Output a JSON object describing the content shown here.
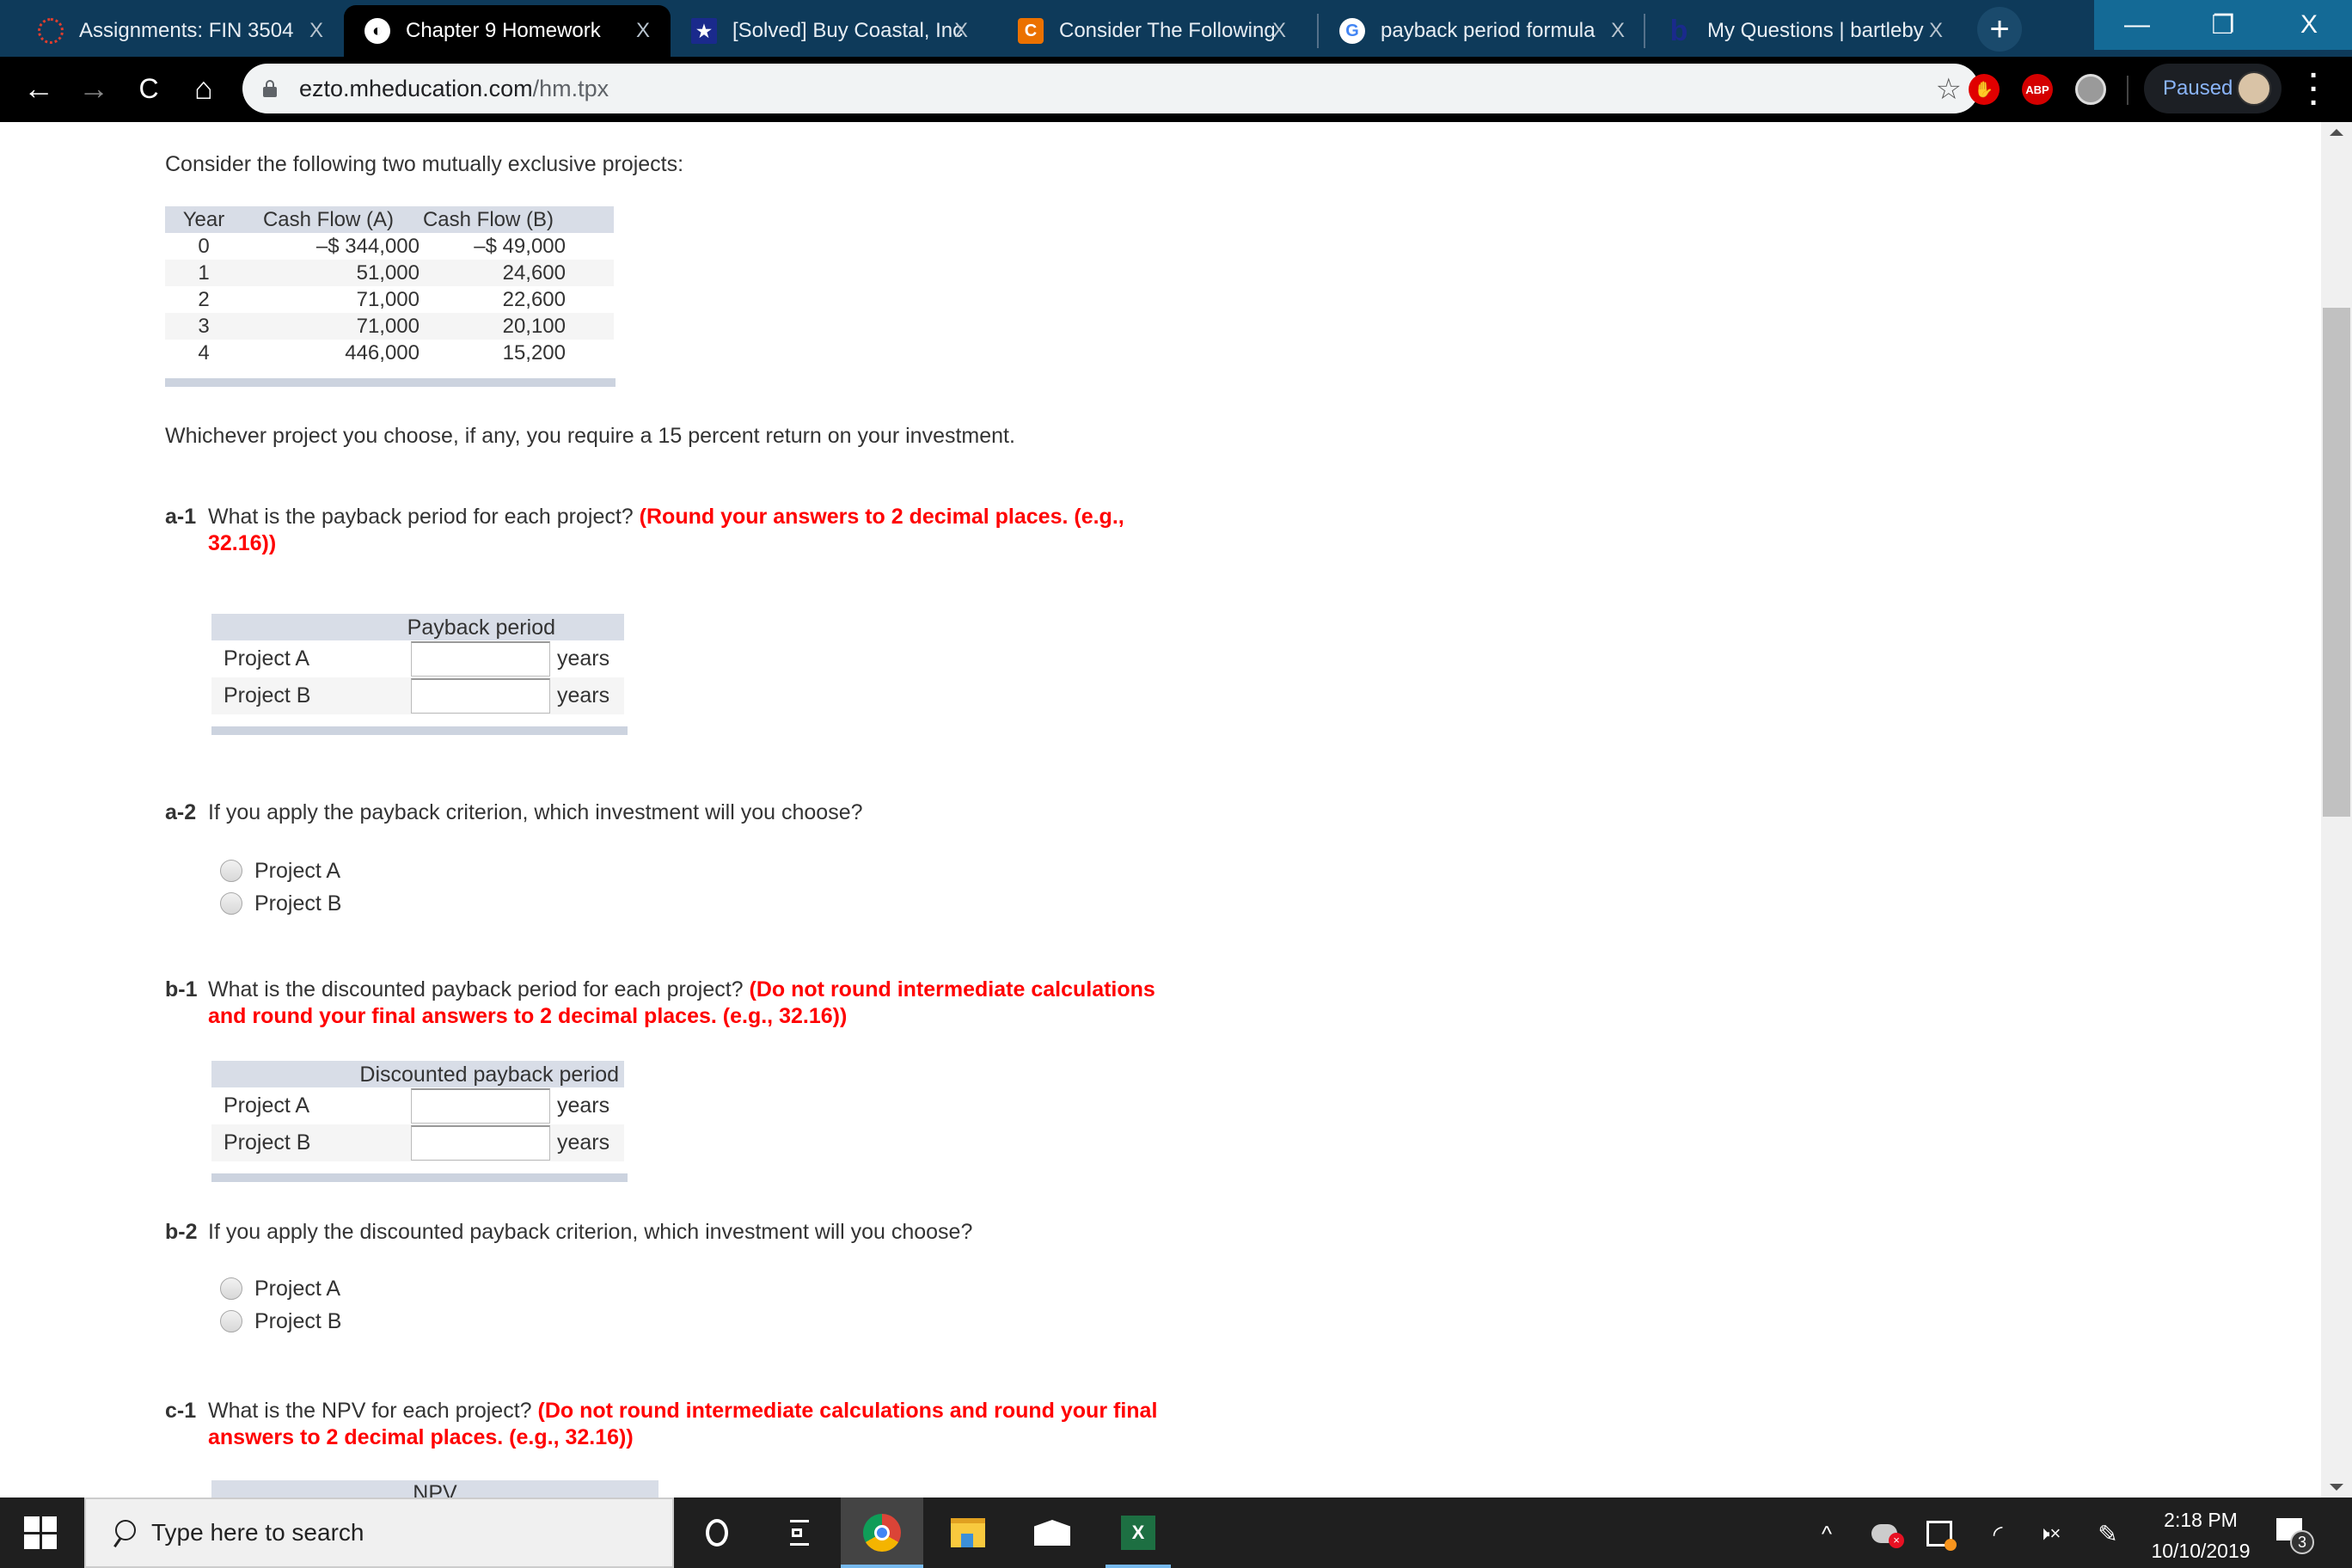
{
  "browser": {
    "tabs": [
      {
        "label": "Assignments: FIN 3504",
        "icon": "canvas-icon",
        "icon_color": "#e03e2d",
        "active": false
      },
      {
        "label": "Chapter 9 Homework",
        "icon": "globe-icon",
        "icon_color": "#ffffff",
        "active": true
      },
      {
        "label": "[Solved] Buy Coastal, Inc",
        "icon": "star-badge-icon",
        "icon_color": "#1a2a8c",
        "active": false
      },
      {
        "label": "Consider The Following",
        "icon": "chegg-icon",
        "icon_color": "#eb7100",
        "active": false
      },
      {
        "label": "payback period formula",
        "icon": "google-icon",
        "icon_color": "#4285f4",
        "active": false
      },
      {
        "label": "My Questions | bartleby",
        "icon": "bartleby-icon",
        "icon_color": "#1a2a8c",
        "active": false
      }
    ],
    "tab_close_glyph": "X",
    "new_tab_glyph": "+",
    "window_controls": {
      "minimize": "—",
      "restore": "❐",
      "close": "X"
    },
    "nav": {
      "back": "←",
      "forward": "→",
      "reload": "C",
      "home": "⌂"
    },
    "url_host": "ezto.mheducation.com",
    "url_path": "/hm.tpx",
    "star_glyph": "☆",
    "extensions": [
      {
        "name": "adblock",
        "label": "✋",
        "color": "#e00000"
      },
      {
        "name": "abp",
        "label": "ABP",
        "color": "#d40000"
      },
      {
        "name": "circle-ext",
        "label": "",
        "color": "#9a9a9a"
      }
    ],
    "profile_status": "Paused",
    "menu_glyph": "⋮"
  },
  "page": {
    "intro": "Consider the following two mutually exclusive projects:",
    "cash_flow_table": {
      "headers": [
        "Year",
        "Cash Flow (A)",
        "Cash Flow (B)"
      ],
      "rows": [
        [
          "0",
          "–$ 344,000",
          "–$ 49,000"
        ],
        [
          "1",
          "51,000",
          "24,600"
        ],
        [
          "2",
          "71,000",
          "22,600"
        ],
        [
          "3",
          "71,000",
          "20,100"
        ],
        [
          "4",
          "446,000",
          "15,200"
        ]
      ]
    },
    "required_return_text": "Whichever project you choose, if any, you require a 15 percent return on your investment.",
    "questions": {
      "a1": {
        "num": "a-1",
        "text": "What is the payback period for each project?",
        "instruction_line1": "(Round your answers to 2 decimal places. (e.g.,",
        "instruction_line2": "32.16))",
        "table_header": "Payback period",
        "rows": [
          {
            "label": "Project A",
            "value": "",
            "unit": "years"
          },
          {
            "label": "Project B",
            "value": "",
            "unit": "years"
          }
        ]
      },
      "a2": {
        "num": "a-2",
        "text": "If you apply the payback criterion, which investment will you choose?",
        "options": [
          "Project A",
          "Project B"
        ]
      },
      "b1": {
        "num": "b-1",
        "text": "What is the discounted payback period for each project?",
        "instruction_line1": "(Do not round intermediate calculations",
        "instruction_line2": "and round your final answers to 2 decimal places. (e.g., 32.16))",
        "table_header": "Discounted payback period",
        "rows": [
          {
            "label": "Project A",
            "value": "",
            "unit": "years"
          },
          {
            "label": "Project B",
            "value": "",
            "unit": "years"
          }
        ]
      },
      "b2": {
        "num": "b-2",
        "text": "If you apply the discounted payback criterion, which investment will you choose?",
        "options": [
          "Project A",
          "Project B"
        ]
      },
      "c1": {
        "num": "c-1",
        "text": "What is the NPV for each project?",
        "instruction_line1": "(Do not round intermediate calculations and round your final",
        "instruction_line2": "answers to 2 decimal places. (e.g., 32.16))",
        "table_header": "NPV"
      }
    }
  },
  "taskbar": {
    "search_placeholder": "Type here to search",
    "apps": [
      "cortana",
      "task-view",
      "chrome",
      "file-explorer",
      "mail",
      "excel"
    ],
    "tray_chevron": "^",
    "volume_glyph": "🕨×",
    "time": "2:18 PM",
    "date": "10/10/2019",
    "notification_count": "3"
  }
}
